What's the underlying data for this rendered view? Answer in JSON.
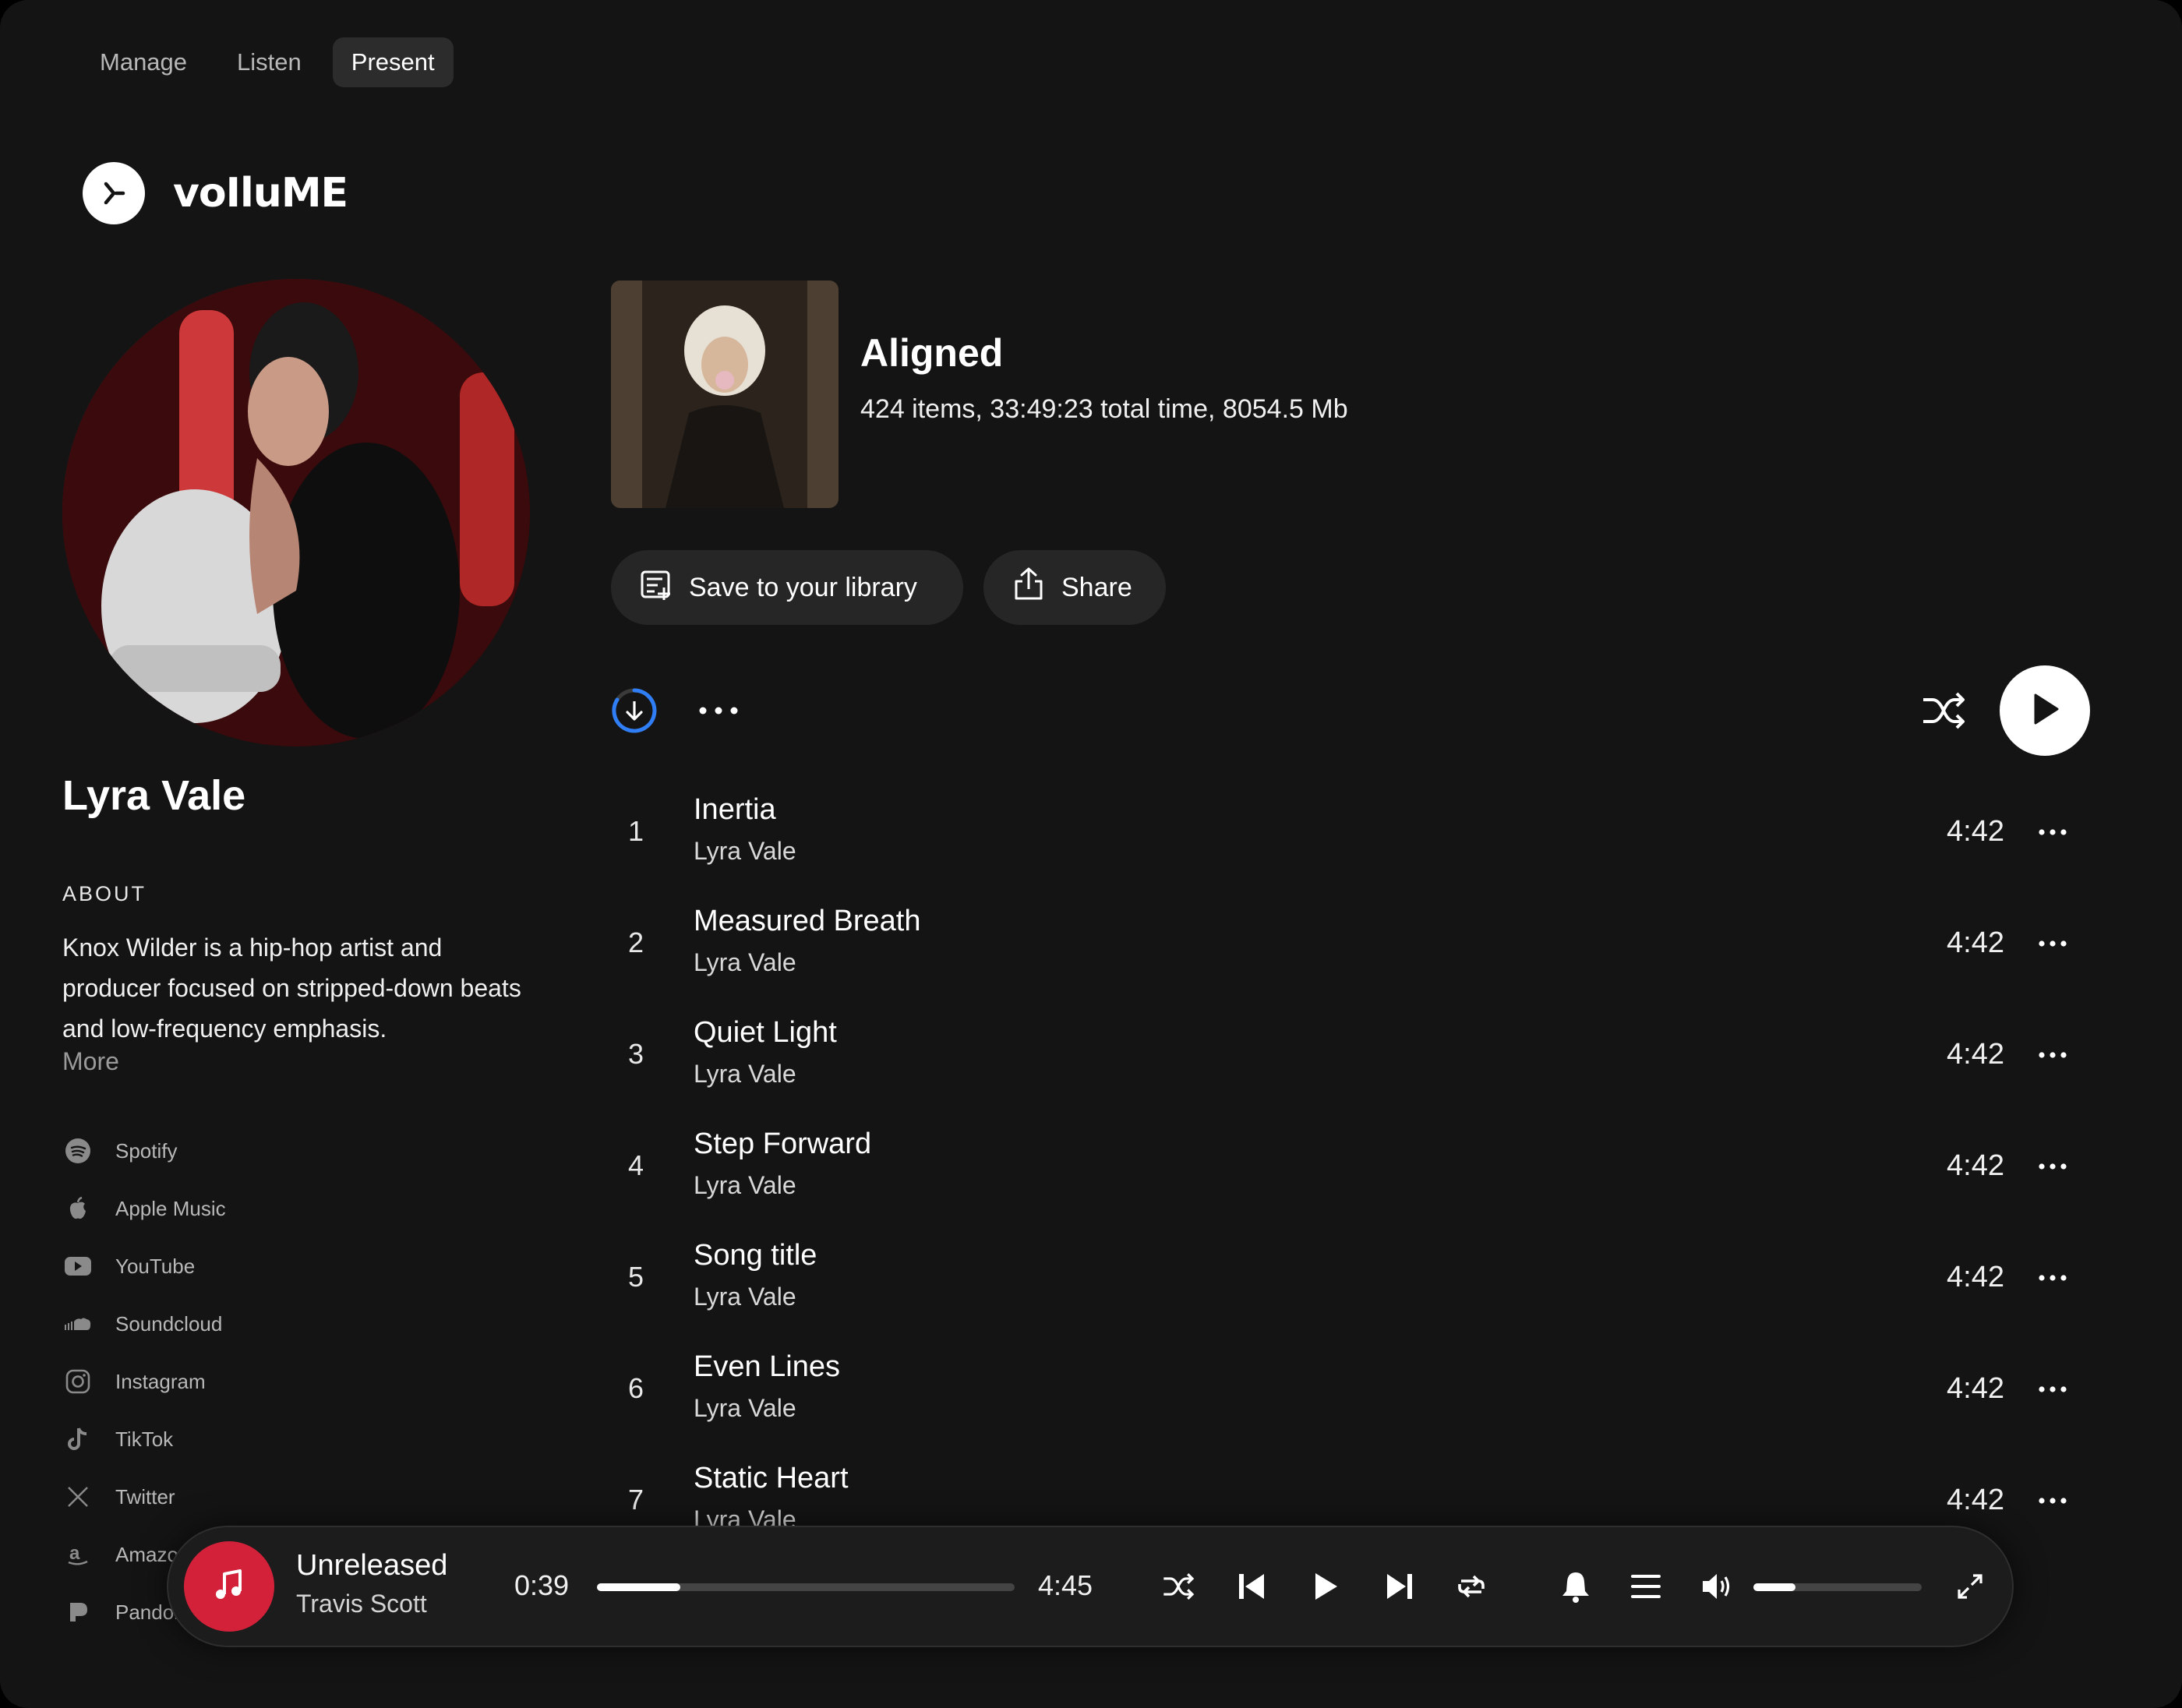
{
  "tabs": [
    {
      "label": "Manage",
      "active": false
    },
    {
      "label": "Listen",
      "active": false
    },
    {
      "label": "Present",
      "active": true
    }
  ],
  "brand": {
    "name": "voIluME"
  },
  "artist": {
    "name": "Lyra Vale",
    "about_label": "ABOUT",
    "about_text": "Knox Wilder is a hip-hop artist and producer focused on stripped-down beats and low-frequency emphasis.",
    "more_label": "More",
    "socials": [
      {
        "label": "Spotify",
        "icon": "spotify-icon"
      },
      {
        "label": "Apple Music",
        "icon": "apple-icon"
      },
      {
        "label": "YouTube",
        "icon": "youtube-icon"
      },
      {
        "label": "Soundcloud",
        "icon": "soundcloud-icon"
      },
      {
        "label": "Instagram",
        "icon": "instagram-icon"
      },
      {
        "label": "TikTok",
        "icon": "tiktok-icon"
      },
      {
        "label": "Twitter",
        "icon": "x-icon"
      },
      {
        "label": "Amazon",
        "icon": "amazon-icon"
      },
      {
        "label": "Pandora",
        "icon": "pandora-icon"
      }
    ]
  },
  "album": {
    "title": "Aligned",
    "meta": "424 items, 33:49:23 total time, 8054.5 Mb",
    "save_label": "Save to your library",
    "share_label": "Share"
  },
  "tracks": [
    {
      "num": "1",
      "title": "Inertia",
      "artist": "Lyra Vale",
      "duration": "4:42"
    },
    {
      "num": "2",
      "title": "Measured Breath",
      "artist": "Lyra Vale",
      "duration": "4:42"
    },
    {
      "num": "3",
      "title": "Quiet Light",
      "artist": "Lyra Vale",
      "duration": "4:42"
    },
    {
      "num": "4",
      "title": "Step Forward",
      "artist": "Lyra Vale",
      "duration": "4:42"
    },
    {
      "num": "5",
      "title": "Song title",
      "artist": "Lyra Vale",
      "duration": "4:42"
    },
    {
      "num": "6",
      "title": "Even Lines",
      "artist": "Lyra Vale",
      "duration": "4:42"
    },
    {
      "num": "7",
      "title": "Static Heart",
      "artist": "Lyra Vale",
      "duration": "4:42"
    }
  ],
  "player": {
    "title": "Unreleased",
    "artist": "Travis Scott",
    "elapsed": "0:39",
    "total": "4:45",
    "progress": 0.2,
    "volume": 0.25,
    "accent": "#d4213a"
  }
}
